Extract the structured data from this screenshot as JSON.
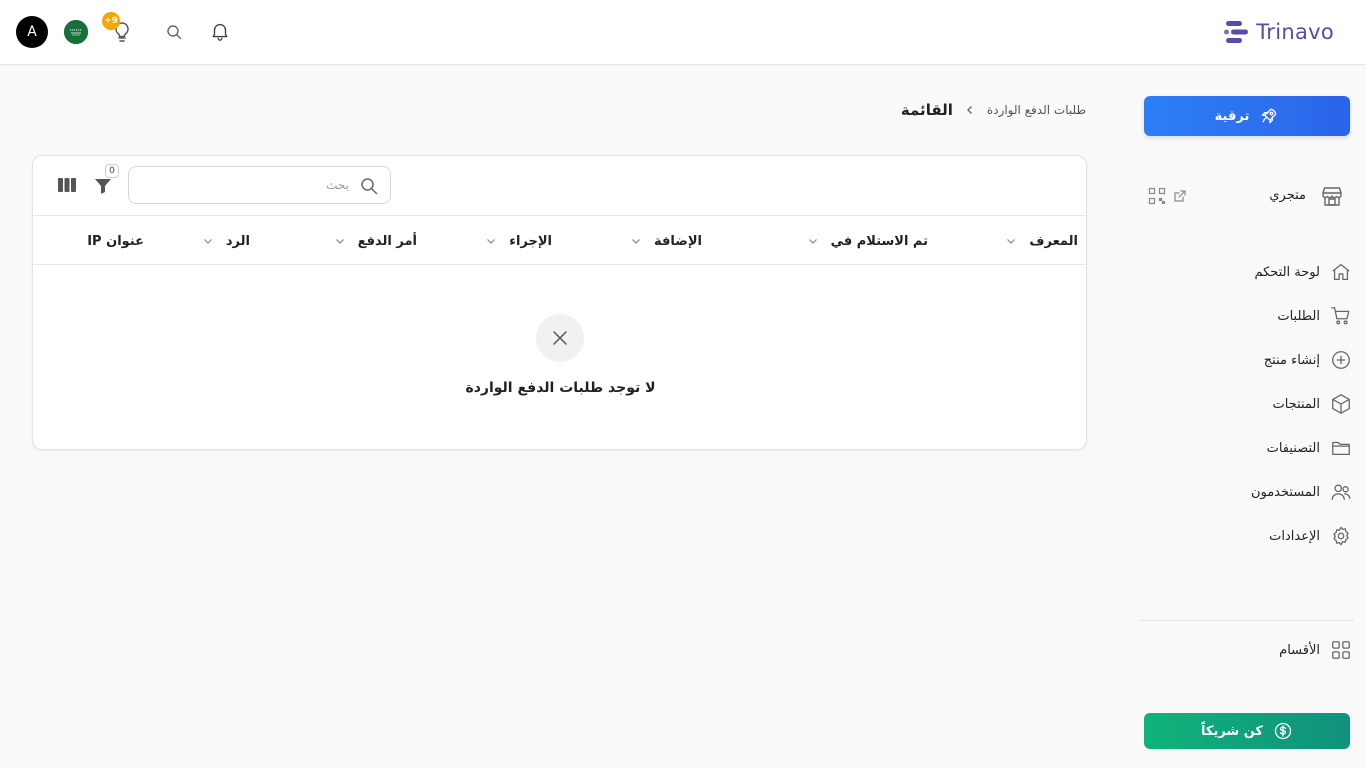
{
  "header": {
    "logo_text": "Trinavo",
    "avatar_letter": "A",
    "notification_badge": "+9"
  },
  "sidebar": {
    "upgrade_label": "ترقية",
    "store_label": "متجري",
    "items": [
      {
        "label": "لوحة التحكم",
        "icon": "home-icon"
      },
      {
        "label": "الطلبات",
        "icon": "cart-icon"
      },
      {
        "label": "إنشاء منتج",
        "icon": "plus-circle-icon"
      },
      {
        "label": "المنتجات",
        "icon": "box-icon"
      },
      {
        "label": "التصنيفات",
        "icon": "folder-icon"
      },
      {
        "label": "المستخدمون",
        "icon": "users-icon"
      },
      {
        "label": "الإعدادات",
        "icon": "gear-icon"
      }
    ],
    "sections_label": "الأقسام",
    "partner_label": "كن شريكاً"
  },
  "breadcrumb": {
    "parent": "طلبات الدفع الواردة",
    "current": "القائمة"
  },
  "table": {
    "search_placeholder": "بحث",
    "filter_count": "0",
    "columns": [
      "المعرف",
      "تم الاستلام في",
      "الإضافة",
      "الإجراء",
      "أمر الدفع",
      "الرد",
      "عنوان IP"
    ],
    "empty_message": "لا توجد طلبات الدفع الواردة"
  },
  "colors": {
    "brand": "#5b4aa8",
    "upgrade": "#2d7ff9",
    "partner": "#0fb37a",
    "badge": "#f5a700"
  }
}
